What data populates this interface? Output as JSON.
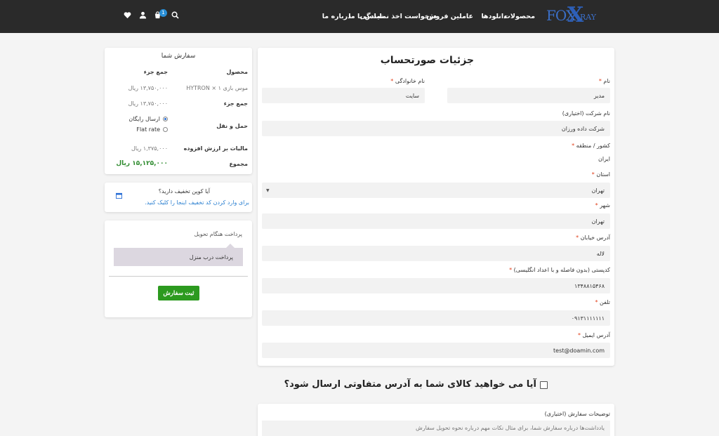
{
  "header": {
    "logo": {
      "part1": "FOX",
      "part2": "X",
      "part3": "RAY"
    },
    "nav": [
      "محصولات",
      "دانلودها",
      "عاملین فروش",
      "درخواست اخذ نمایندگی",
      "تماس با ما",
      "درباره ما"
    ],
    "cart_count": "1",
    "icons": [
      "search-icon",
      "cart-icon",
      "user-icon",
      "heart-icon",
      "chevron-down-icon"
    ]
  },
  "billing": {
    "title": "جزئیات صورتحساب",
    "first_name": {
      "label": "نام",
      "value": "مدیر"
    },
    "last_name": {
      "label": "نام خانوادگی",
      "value": "سایت"
    },
    "company": {
      "label": "نام شرکت (اختیاری)",
      "value": "شرکت داده ورزان"
    },
    "country": {
      "label": "کشور / منطقه",
      "value": "ایران"
    },
    "state": {
      "label": "استان",
      "value": "تهران"
    },
    "city": {
      "label": "شهر",
      "value": "تهران"
    },
    "address": {
      "label": "آدرس خیابان",
      "value": "لاله"
    },
    "postcode": {
      "label": "کدپستی (بدون فاصله و با اعداد انگلیسی)",
      "value": "۱۳۴۸۸۱۵۴۶۸"
    },
    "phone": {
      "label": "تلفن",
      "value": "۰۹۱۳۱۱۱۱۱۱۱"
    },
    "email": {
      "label": "آدرس ایمیل",
      "value": "test@doamin.com"
    },
    "required_mark": "*"
  },
  "order": {
    "title": "سفارش شما",
    "col_product": "محصول",
    "col_subtotal": "جمع جزء",
    "item_name": "موس بازی HYTRON",
    "item_qty": "× ۱",
    "item_price": "۱۳,۷۵۰,۰۰۰ ریال",
    "subtotal_label": "جمع جزء",
    "subtotal_value": "۱۳,۷۵۰,۰۰۰ ریال",
    "shipping_label": "حمل و نقل",
    "shipping_free": "ارسال رایگان",
    "shipping_flat": "Flat rate",
    "tax_label": "مالیات بر ارزش افزوده",
    "tax_value": "۱,۳۷۵,۰۰۰ ریال",
    "total_label": "مجموع",
    "total_value": "۱۵,۱۲۵,۰۰۰ ریال"
  },
  "coupon": {
    "question": "آیا کوپن تخفیف دارید؟",
    "link": "برای وارد کردن کد تخفیف اینجا را کلیک کنید."
  },
  "payment": {
    "method": "پرداخت هنگام تحویل",
    "description": "پرداخت درب منزل",
    "submit": "ثبت سفارش"
  },
  "shipping_question": "آیا می خواهید کالای شما به آدرس متفاوتی ارسال شود؟",
  "notes": {
    "label": "توضیحات سفارش (اختیاری)",
    "placeholder": "یادداشت‌ها درباره سفارش شما، برای مثال نکات مهم درباره نحوه تحویل سفارش"
  },
  "colors": {
    "header_bg": "#2a2a2a",
    "accent_blue": "#2a8fd6",
    "submit_green": "#2c9a1f",
    "total_green": "#2e8b2e",
    "required_red": "#e2401c"
  }
}
